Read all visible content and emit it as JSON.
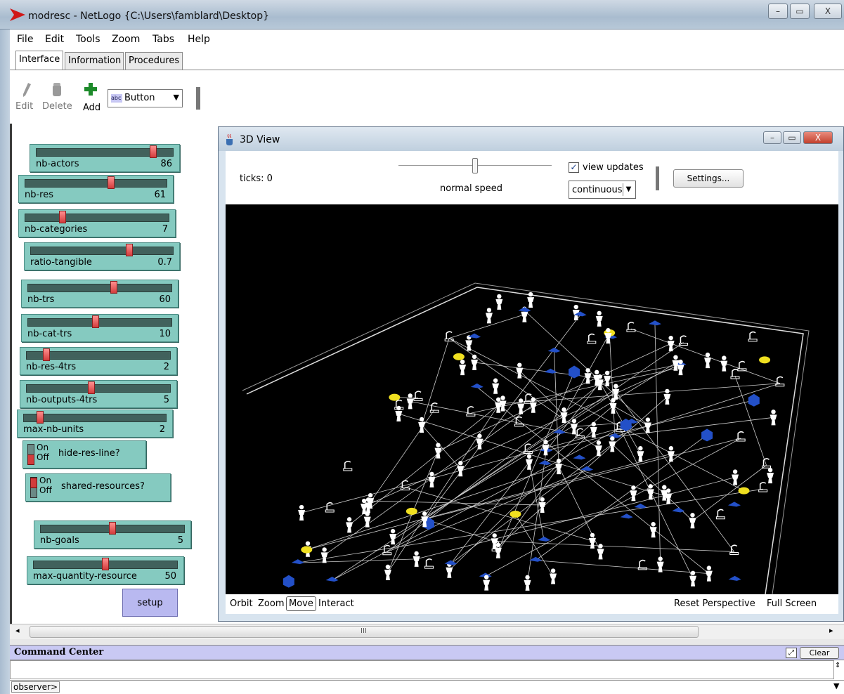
{
  "window": {
    "title": "modresc - NetLogo {C:\\Users\\famblard\\Desktop}",
    "minimize": "–",
    "maximize": "▭",
    "close": "X"
  },
  "menu": [
    "File",
    "Edit",
    "Tools",
    "Zoom",
    "Tabs",
    "Help"
  ],
  "tabs": [
    "Interface",
    "Information",
    "Procedures"
  ],
  "toolbar": {
    "edit": "Edit",
    "delete": "Delete",
    "add": "Add",
    "widget_type": "Button",
    "widget_badge": "abc"
  },
  "sliders": [
    {
      "label": "nb-actors",
      "value": "86",
      "pos": 0.87
    },
    {
      "label": "nb-res",
      "value": "61",
      "pos": 0.61
    },
    {
      "label": "nb-categories",
      "value": "7",
      "pos": 0.25
    },
    {
      "label": "ratio-tangible",
      "value": "0.7",
      "pos": 0.7
    },
    {
      "label": "nb-trs",
      "value": "60",
      "pos": 0.6
    },
    {
      "label": "nb-cat-trs",
      "value": "10",
      "pos": 0.47
    },
    {
      "label": "nb-res-4trs",
      "value": "2",
      "pos": 0.12
    },
    {
      "label": "nb-outputs-4trs",
      "value": "5",
      "pos": 0.45
    },
    {
      "label": "max-nb-units",
      "value": "2",
      "pos": 0.1
    },
    {
      "label": "nb-goals",
      "value": "5",
      "pos": 0.5
    },
    {
      "label": "max-quantity-resource",
      "value": "50",
      "pos": 0.5
    }
  ],
  "switches": [
    {
      "label": "hide-res-line?",
      "on": "On",
      "off": "Off",
      "state": "off"
    },
    {
      "label": "shared-resources?",
      "on": "On",
      "off": "Off",
      "state": "on"
    }
  ],
  "setup_label": "setup",
  "view3d": {
    "title": "3D View",
    "ticks_label": "ticks: 0",
    "speed_label": "normal speed",
    "speed": 0.5,
    "view_updates_label": "view updates",
    "view_updates_checked": true,
    "update_mode": "continuous",
    "settings_label": "Settings...",
    "modes": [
      "Orbit",
      "Zoom",
      "Move",
      "Interact"
    ],
    "active_mode": "Move",
    "reset_label": "Reset Perspective",
    "fullscreen_label": "Full Screen"
  },
  "scroll_mid": "III",
  "command_center": {
    "title": "Command Center",
    "clear_label": "Clear",
    "prompt": "observer>"
  },
  "colors": {
    "slider": "#85cac0",
    "switch": "#85cac0",
    "button": "#b9b9f0",
    "command_bar": "#c9c9f3",
    "canvas": "#000000",
    "agent_white": "#ffffff",
    "agent_blue": "#2350c8",
    "agent_yellow": "#f0e020"
  },
  "icons": {
    "app": "netlogo-logo-icon",
    "java": "java-cup-icon",
    "edit": "pencil-icon",
    "delete": "trash-icon",
    "add": "plus-icon"
  }
}
